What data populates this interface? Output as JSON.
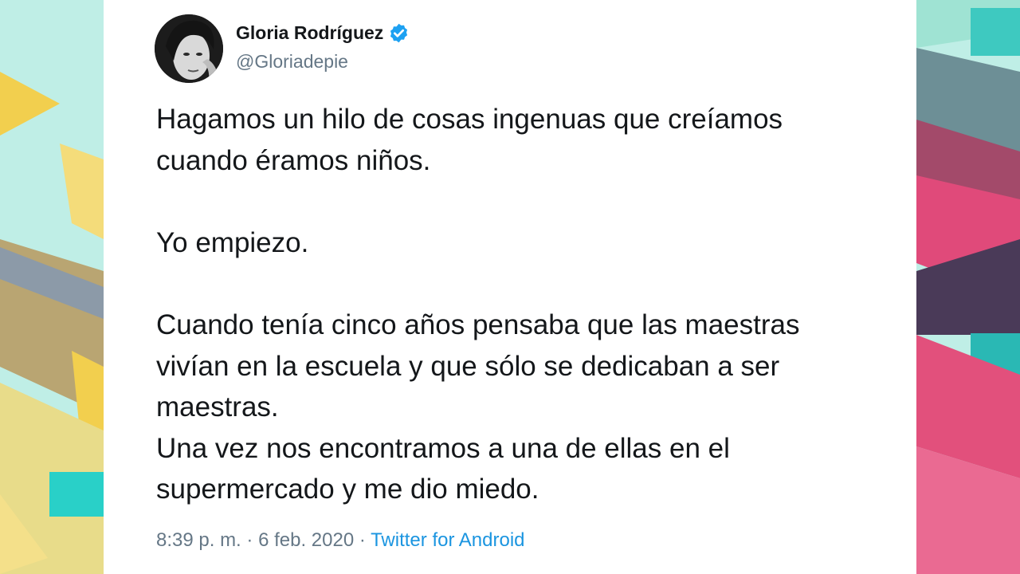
{
  "tweet": {
    "author_name": "Gloria Rodríguez",
    "handle": "@Gloriadepie",
    "verified": true,
    "lines": {
      "l1": "Hagamos un hilo de cosas ingenuas que creíamos",
      "l2": "cuando éramos niños.",
      "l3": "Yo empiezo.",
      "l4": "Cuando tenía cinco años pensaba que las maestras",
      "l5": "vivían en la escuela y que sólo se dedicaban a ser",
      "l6": "maestras.",
      "l7": "Una vez nos encontramos a una de ellas en el",
      "l8": "supermercado y me dio miedo."
    },
    "time": "8:39 p. m.",
    "separator": "·",
    "date": "6 feb. 2020",
    "source": "Twitter for Android"
  },
  "colors": {
    "text": "#14171a",
    "secondary": "#657786",
    "link": "#1b95e0",
    "verified": "#1da1f2"
  }
}
